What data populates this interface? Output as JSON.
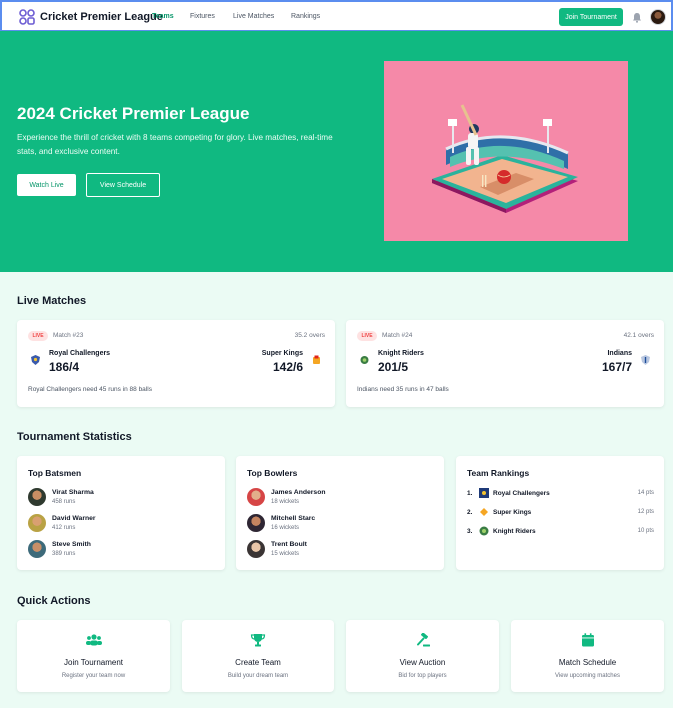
{
  "nav": {
    "brand": "Cricket Premier League",
    "links": [
      "Teams",
      "Fixtures",
      "Live Matches",
      "Rankings"
    ],
    "join_button": "Join Tournament"
  },
  "hero": {
    "title": "2024 Cricket Premier League",
    "subtitle": "Experience the thrill of cricket with 8 teams competing for glory. Live matches, real-time stats, and exclusive content.",
    "primary_button": "Watch Live",
    "secondary_button": "View Schedule"
  },
  "live_matches": {
    "title": "Live Matches",
    "matches": [
      {
        "badge": "LIVE",
        "match_no": "Match #23",
        "overs": "35.2 overs",
        "team1": "Royal Challengers",
        "score1": "186/4",
        "team2": "Super Kings",
        "score2": "142/6",
        "status": "Royal Challengers need 45 runs in 88 balls"
      },
      {
        "badge": "LIVE",
        "match_no": "Match #24",
        "overs": "42.1 overs",
        "team1": "Knight Riders",
        "score1": "201/5",
        "team2": "Indians",
        "score2": "167/7",
        "status": "Indians need 35 runs in 47 balls"
      }
    ]
  },
  "stats": {
    "title": "Tournament Statistics",
    "batsmen": {
      "title": "Top Batsmen",
      "players": [
        {
          "name": "Virat Sharma",
          "value": "458 runs"
        },
        {
          "name": "David Warner",
          "value": "412 runs"
        },
        {
          "name": "Steve Smith",
          "value": "389 runs"
        }
      ]
    },
    "bowlers": {
      "title": "Top Bowlers",
      "players": [
        {
          "name": "James Anderson",
          "value": "18 wickets"
        },
        {
          "name": "Mitchell Starc",
          "value": "16 wickets"
        },
        {
          "name": "Trent Boult",
          "value": "15 wickets"
        }
      ]
    },
    "rankings": {
      "title": "Team Rankings",
      "teams": [
        {
          "rank": "1.",
          "name": "Royal Challengers",
          "pts": "14 pts"
        },
        {
          "rank": "2.",
          "name": "Super Kings",
          "pts": "12 pts"
        },
        {
          "rank": "3.",
          "name": "Knight Riders",
          "pts": "10 pts"
        }
      ]
    }
  },
  "quick_actions": {
    "title": "Quick Actions",
    "items": [
      {
        "title": "Join Tournament",
        "sub": "Register your team now",
        "icon": "users-icon"
      },
      {
        "title": "Create Team",
        "sub": "Build your dream team",
        "icon": "trophy-icon"
      },
      {
        "title": "View Auction",
        "sub": "Bid for top players",
        "icon": "gavel-icon"
      },
      {
        "title": "Match Schedule",
        "sub": "View upcoming matches",
        "icon": "calendar-icon"
      }
    ]
  },
  "colors": {
    "primary": "#10b981",
    "hero_image_bg": "#f589a8",
    "live": "#ef4444",
    "page_bg": "#ebfbf4"
  }
}
